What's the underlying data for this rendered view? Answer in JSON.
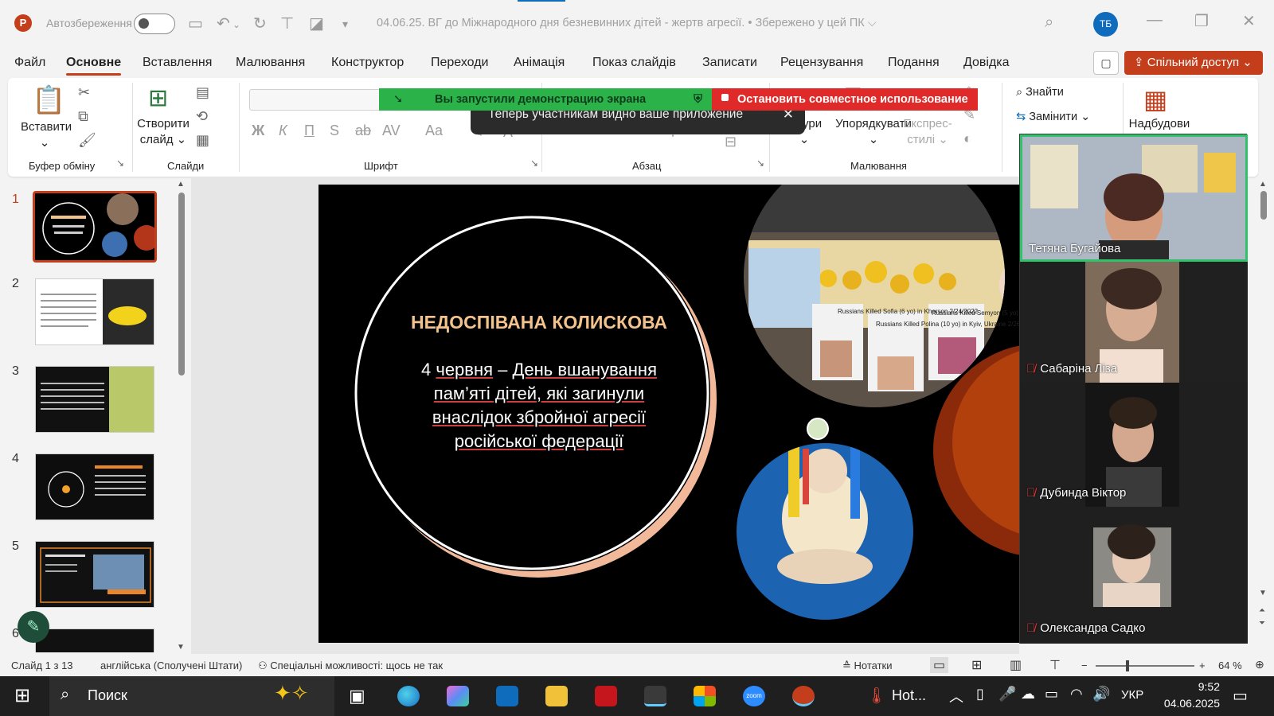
{
  "titlebar": {
    "app_initials": "P",
    "autosave_label": "Автозбереження",
    "document_title": "04.06.25. ВГ до Міжнародного дня безневинних дітей - жертв агресії. • Збережено у цей ПК ⌵",
    "user_initials": "ТБ"
  },
  "menu": {
    "items": [
      "Файл",
      "Основне",
      "Вставлення",
      "Малювання",
      "Конструктор",
      "Переходи",
      "Анімація",
      "Показ слайдів",
      "Записати",
      "Рецензування",
      "Подання",
      "Довідка"
    ],
    "active": "Основне",
    "share_label": "Спільний доступ"
  },
  "ribbon": {
    "paste_label": "Вставити",
    "new_slide_label": "Створити слайд",
    "clipboard_group": "Буфер обміну",
    "slides_group": "Слайди",
    "font_group": "Шрифт",
    "paragraph_group": "Абзац",
    "drawing_group": "Малювання",
    "shapes_label": "Фігури",
    "arrange_label": "Упорядкувати",
    "quick_styles_label": "Експрес-стилі",
    "find_label": "Знайти",
    "replace_label": "Замінити",
    "addins_label": "Надбудови",
    "format_buttons": [
      "Ж",
      "К",
      "П",
      "S",
      "ab",
      "AV",
      "Aa"
    ]
  },
  "share_banner": {
    "active_text": "Вы запустили демонстрацию экрана",
    "stop_text": "Остановить совместное использование",
    "toast_text": "Теперь участникам видно ваше приложение",
    "green": "#2bb34a",
    "red": "#e02a2a"
  },
  "thumbnails": {
    "numbers": [
      "1",
      "2",
      "3",
      "4",
      "5",
      "6"
    ],
    "selected": "1"
  },
  "slide": {
    "title": "НЕДОСПІВАНА КОЛИСКОВА",
    "body_prefix": "4 ",
    "body_underlined": "червня",
    "body_middle": " – ",
    "body_rest": "День вшанування пам’яті дітей, які загинули внаслідок збройної агресії російської федерації",
    "memorial_texts": [
      "Russians Killed Sofia (6 yo) in Kherson 2/24/2022",
      "Russians Killed Polina (10 yo) in Kyiv, Ukraine 2/26/2022",
      "Russians Killed Semyon (5 yo) in Kyiv, Ukraine 2/26/2022"
    ]
  },
  "participants": [
    {
      "name": "Тетяна Бугайова",
      "muted": false,
      "active": true
    },
    {
      "name": "Сабаріна Ліза",
      "muted": true,
      "active": false
    },
    {
      "name": "Дубинда Віктор",
      "muted": true,
      "active": false
    },
    {
      "name": "Олександра Садко",
      "muted": true,
      "active": false
    }
  ],
  "statusbar": {
    "slide_info": "Слайд 1 з 13",
    "language": "англійська (Сполучені Штати)",
    "accessibility": "Спеціальні можливості: щось не так",
    "notes_label": "Нотатки",
    "zoom": "64 %"
  },
  "taskbar": {
    "search_label": "Поиск",
    "weather_label": "Hot...",
    "language": "УКР",
    "time": "9:52",
    "date": "04.06.2025"
  },
  "colors": {
    "accent": "#c43e1c",
    "slide_title": "#f4c28c"
  }
}
